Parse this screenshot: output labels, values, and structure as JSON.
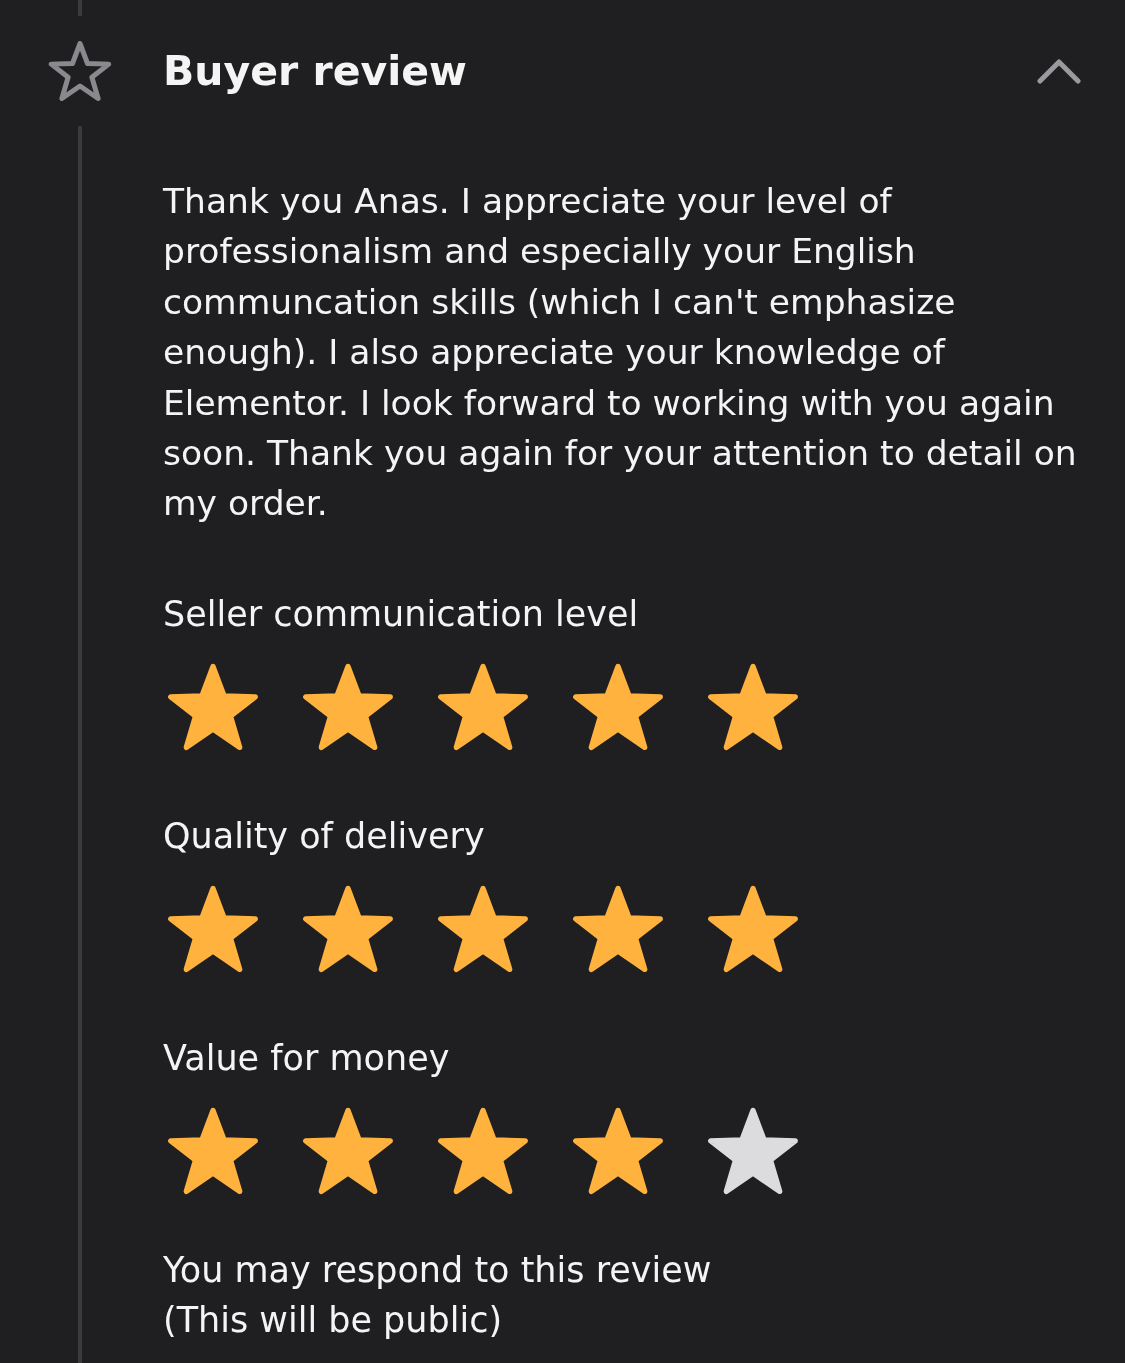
{
  "header": {
    "title": "Buyer review",
    "expanded": true
  },
  "review": {
    "text": "Thank you Anas. I appreciate your level of professionalism and especially your English communcation skills (which I can't emphasize enough). I also appreciate your knowledge of Elementor. I look forward to working with you again soon. Thank you again for your attention to detail on my order."
  },
  "ratings": [
    {
      "label": "Seller communication level",
      "stars": 5
    },
    {
      "label": "Quality of delivery",
      "stars": 5
    },
    {
      "label": "Value for money",
      "stars": 4
    }
  ],
  "respond": {
    "lines": [
      "You may respond to this review",
      "(This will be public)"
    ]
  }
}
